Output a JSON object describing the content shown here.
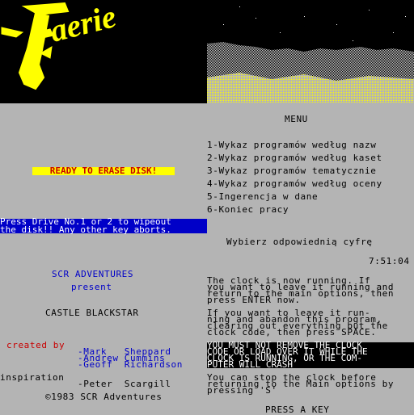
{
  "logo_text": "Faerie",
  "colors": {
    "yellow": "#ffff00",
    "blue": "#0000c8",
    "red": "#c80000",
    "grey": "#b4b4b4"
  },
  "menu": {
    "title": "MENU",
    "items": [
      "1-Wykaz programów według nazw",
      "2-Wykaz programów według kaset",
      "3-Wykaz programów tematycznie",
      "4-Wykaz programów według oceny",
      "5-Ingerencja w dane",
      "6-Koniec pracy"
    ]
  },
  "erase_label": "READY TO ERASE DISK!",
  "wipe_lines": [
    "Press Drive No.1 or 2 to wipeout",
    "the disk!! Any other key aborts."
  ],
  "prompt": "Wybierz odpowiednią cyfrę",
  "clock": "7:51:04",
  "credits": {
    "company": "SCR ADVENTURES",
    "present": "present",
    "game": "CASTLE BLACKSTAR",
    "created_by": "created by",
    "authors": [
      "-Mark   Sheppard",
      "-Andrew Cummins",
      "-Geoff  Richardson"
    ],
    "inspiration": "inspiration",
    "inspiration_author": "-Peter  Scargill",
    "copyright": "©1983 SCR Adventures"
  },
  "clock_info": {
    "p1": [
      "The clock is now running. If",
      "you want to leave it running and",
      "return to the main options, then",
      "press ENTER now."
    ],
    "p2": [
      "If you want to leave it run-",
      "ning and abandon this program,",
      "clearing out everything but the",
      "clock code, then press SPACE."
    ],
    "warning": [
      "YOU MUST NOT REMOVE THE CLOCK",
      "CODE OR LOAD OVER IT WHILE THE",
      "CLOCK IS RUNNING, OR THE COM-",
      "PUTER WILL CRASH"
    ],
    "p3": [
      "You can stop the clock before",
      "returning to the Main options by",
      "pressing 'S'"
    ],
    "press_key": "PRESS A KEY"
  }
}
